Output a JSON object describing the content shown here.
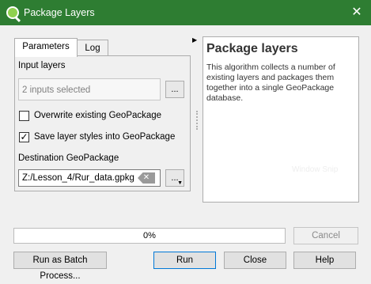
{
  "window": {
    "title": "Package Layers",
    "close_glyph": "✕",
    "icon": "qgis-icon",
    "title_bar_color": "#2e7d32"
  },
  "tabs": [
    {
      "label": "Parameters",
      "active": true
    },
    {
      "label": "Log",
      "active": false
    }
  ],
  "parameters": {
    "input_layers_label": "Input layers",
    "input_layers_value": "2 inputs selected",
    "input_layers_button": "...",
    "overwrite_label": "Overwrite existing GeoPackage",
    "overwrite_checked": false,
    "save_styles_label": "Save layer styles into GeoPackage",
    "save_styles_checked": true,
    "save_styles_mark": "✓",
    "destination_label": "Destination GeoPackage",
    "destination_value": "Z:/Lesson_4/Rur_data.gpkg",
    "destination_button": "...",
    "clear_glyph": "✕"
  },
  "help": {
    "title": "Package layers",
    "description": "This algorithm collects a number of existing layers and packages them together into a single GeoPackage database.",
    "watermark": "Window Snip"
  },
  "progress": {
    "value": 0,
    "text": "0%"
  },
  "buttons": {
    "cancel": "Cancel",
    "batch": "Run as Batch Process...",
    "run": "Run",
    "close": "Close",
    "help": "Help"
  }
}
